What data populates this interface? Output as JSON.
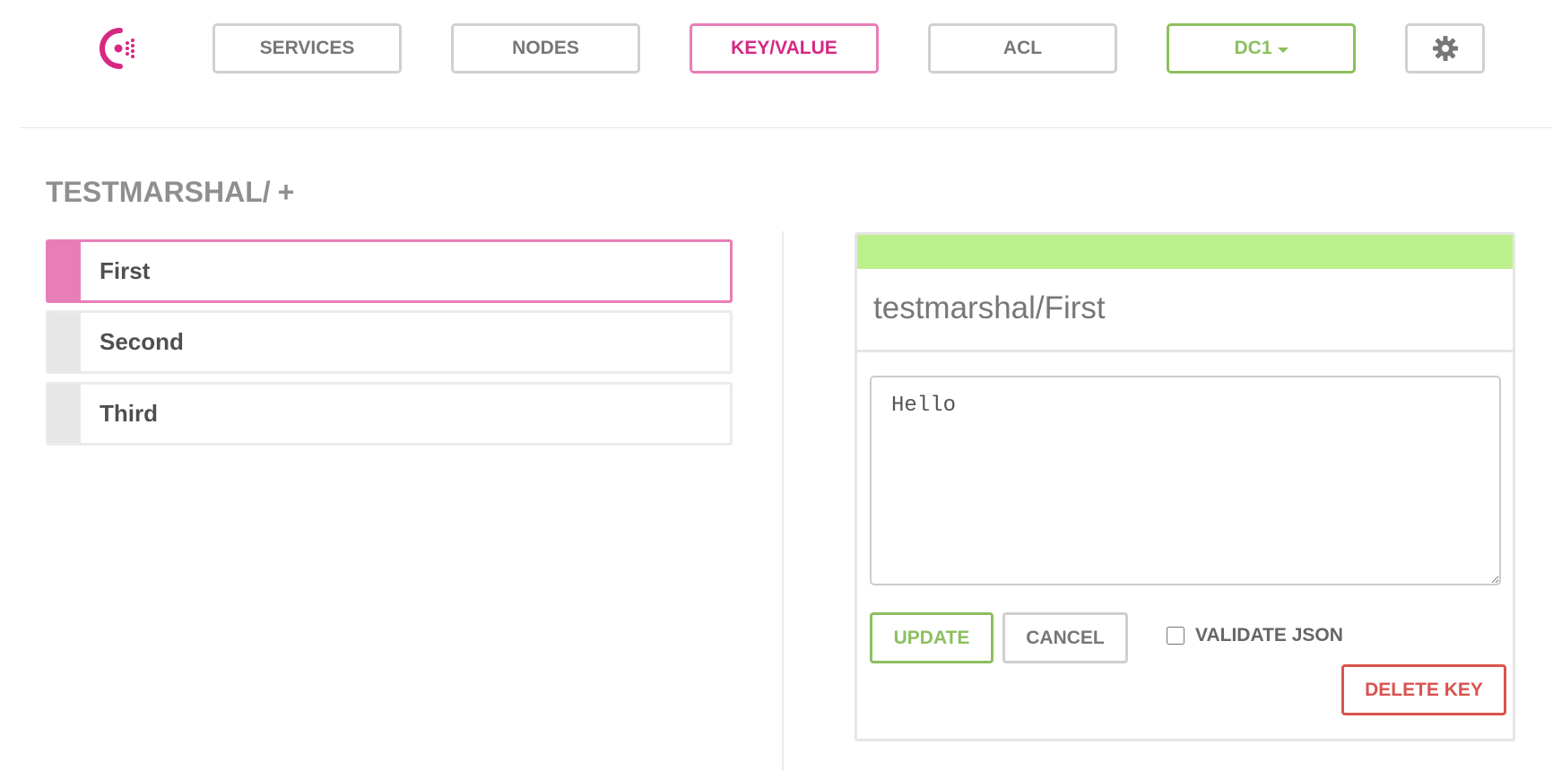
{
  "nav": {
    "services": "SERVICES",
    "nodes": "NODES",
    "keyvalue": "KEY/VALUE",
    "acl": "ACL",
    "datacenter": "DC1",
    "active": "KEY/VALUE",
    "settings_icon": "gear-icon",
    "logo_icon": "consul-logo-icon"
  },
  "breadcrumb": {
    "path": "TESTMARSHAL/",
    "add": "+"
  },
  "keys": [
    {
      "label": "First",
      "selected": true
    },
    {
      "label": "Second",
      "selected": false
    },
    {
      "label": "Third",
      "selected": false
    }
  ],
  "editor": {
    "key": "testmarshal/First",
    "value": "Hello",
    "update": "UPDATE",
    "cancel": "CANCEL",
    "validate_json": "VALIDATE JSON",
    "validate_checked": false,
    "delete": "DELETE KEY"
  },
  "colors": {
    "brand": "#d62783",
    "active_border": "#e87eb7",
    "green": "#8cbf5f",
    "status_bar": "#bcf08c",
    "danger": "#d9534f"
  }
}
